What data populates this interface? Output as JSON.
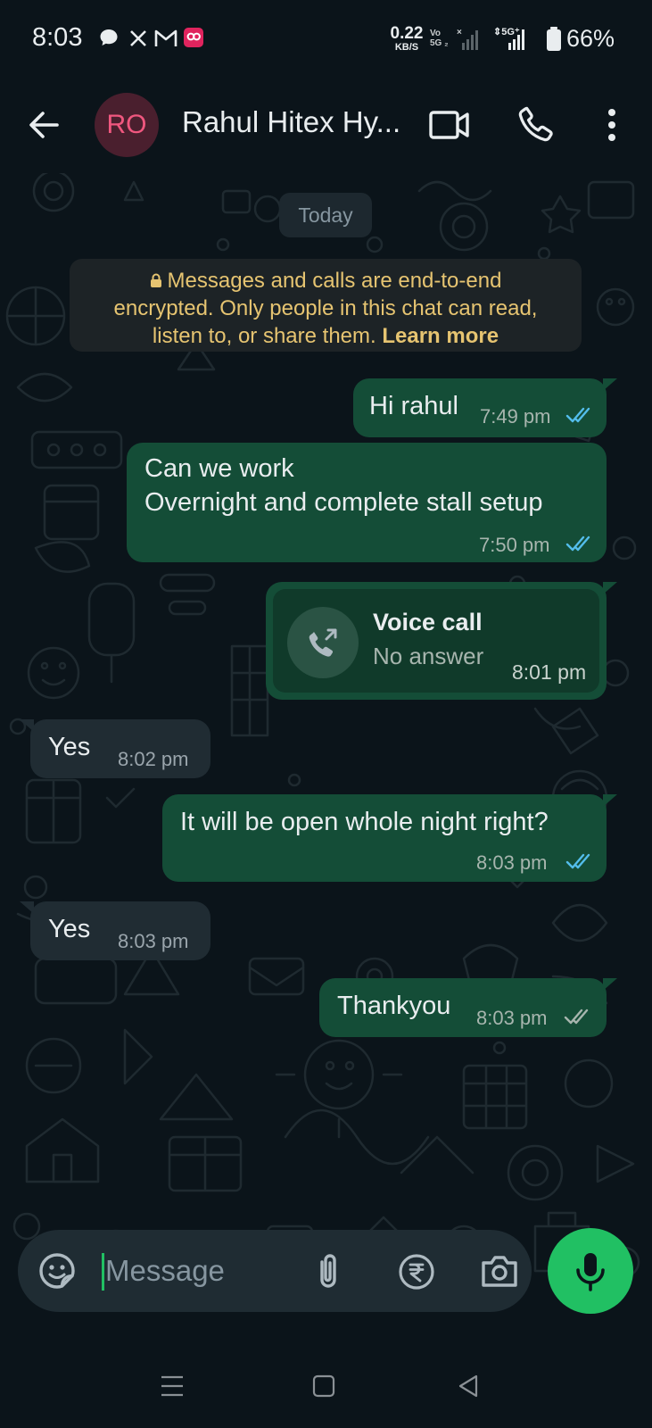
{
  "status_bar": {
    "time": "8:03",
    "net_speed_value": "0.22",
    "net_speed_unit": "KB/S",
    "volte_top": "Vo",
    "volte_bottom": "5G ₂",
    "network": "5G",
    "battery": "66%",
    "notification_icons": [
      "chat-bubble-icon",
      "x-icon",
      "gmail-icon",
      "app-icon"
    ]
  },
  "header": {
    "avatar_initials": "RO",
    "contact_name": "Rahul Hitex Hy...",
    "avatar_color": "#f0577f"
  },
  "chat": {
    "date_label": "Today",
    "encryption_notice": {
      "line1": "Messages and calls are end-to-end",
      "line2": "encrypted. Only people in this chat can read,",
      "line3_prefix": "listen to, or share them.",
      "link": "Learn more"
    },
    "messages": [
      {
        "direction": "out",
        "lines": [
          "Hi rahul"
        ],
        "time": "7:49 pm",
        "status": "read"
      },
      {
        "direction": "out",
        "lines": [
          "Can we work",
          "Overnight and complete stall setup"
        ],
        "time": "7:50 pm",
        "status": "read"
      },
      {
        "direction": "out",
        "type": "voice_call",
        "title": "Voice call",
        "subtitle": "No answer",
        "time": "8:01 pm"
      },
      {
        "direction": "in",
        "lines": [
          "Yes"
        ],
        "time": "8:02 pm"
      },
      {
        "direction": "out",
        "lines": [
          "It will be open whole night right?"
        ],
        "time": "8:03 pm",
        "status": "read"
      },
      {
        "direction": "in",
        "lines": [
          "Yes"
        ],
        "time": "8:03 pm"
      },
      {
        "direction": "out",
        "lines": [
          "Thankyou"
        ],
        "time": "8:03 pm",
        "status": "delivered"
      }
    ]
  },
  "input_bar": {
    "placeholder": "Message"
  },
  "colors": {
    "background": "#0b141a",
    "outgoing_bubble": "#144d37",
    "incoming_bubble": "#202c33",
    "accent_green": "#21c063",
    "read_ticks": "#53bdeb",
    "notice_text": "#e6c471"
  }
}
